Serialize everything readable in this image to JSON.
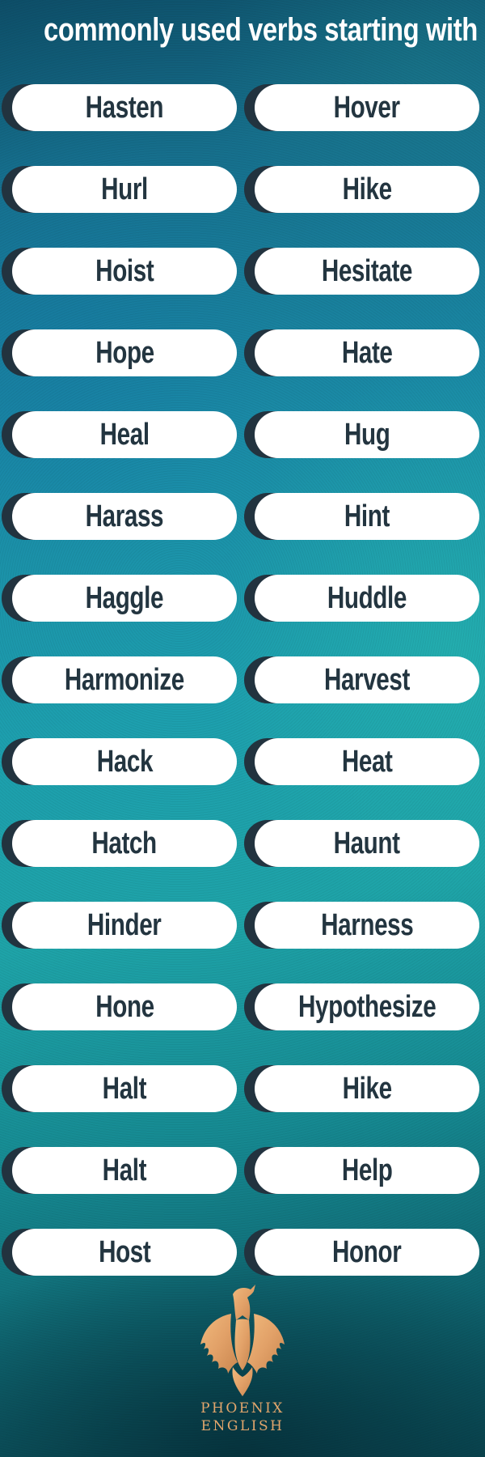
{
  "title": "commonly used verbs starting with H",
  "colors": {
    "pill_background": "#ffffff",
    "pill_shadow": "#22333f",
    "verb_text": "#233540",
    "title_text": "#ffffff",
    "logo_gold": "#e3a66c"
  },
  "verbs": [
    {
      "left": "Hasten",
      "right": "Hover"
    },
    {
      "left": "Hurl",
      "right": "Hike"
    },
    {
      "left": "Hoist",
      "right": "Hesitate"
    },
    {
      "left": "Hope",
      "right": "Hate"
    },
    {
      "left": "Heal",
      "right": "Hug"
    },
    {
      "left": "Harass",
      "right": "Hint"
    },
    {
      "left": "Haggle",
      "right": "Huddle"
    },
    {
      "left": "Harmonize",
      "right": "Harvest"
    },
    {
      "left": "Hack",
      "right": "Heat"
    },
    {
      "left": "Hatch",
      "right": "Haunt"
    },
    {
      "left": "Hinder",
      "right": "Harness"
    },
    {
      "left": "Hone",
      "right": "Hypothesize"
    },
    {
      "left": "Halt",
      "right": "Hike"
    },
    {
      "left": "Halt",
      "right": "Help"
    },
    {
      "left": "Host",
      "right": "Honor"
    }
  ],
  "logo": {
    "icon": "phoenix-bird-icon",
    "line1": "PHOENIX",
    "line2": "ENGLISH"
  }
}
